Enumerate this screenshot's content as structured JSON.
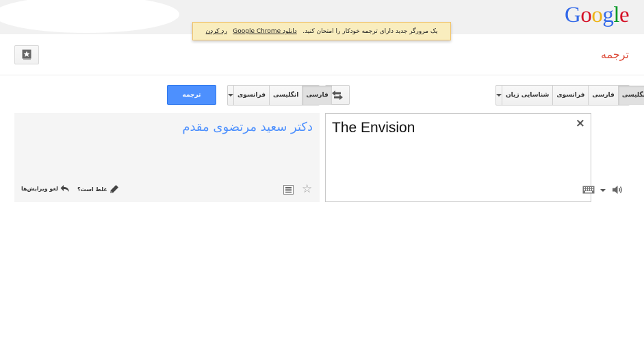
{
  "header": {
    "logo_letters": [
      "G",
      "o",
      "o",
      "g",
      "l",
      "e"
    ],
    "logo_colors": [
      "#3369e8",
      "#d50f25",
      "#eeb211",
      "#3369e8",
      "#009925",
      "#d50f25"
    ],
    "title": "ترجمه"
  },
  "notice": {
    "text": "یک مرورگر جدید دارای ترجمه خودکار را امتحان کنید.",
    "download_link": "دانلود Google Chrome",
    "dismiss_link": "رد کردن"
  },
  "source_langs": {
    "items": [
      "انگلیسی",
      "فارسی",
      "فرانسوی",
      "شناسایی زبان"
    ],
    "selected": "انگلیسی"
  },
  "target_langs": {
    "items": [
      "فارسی",
      "انگلیسی",
      "فرانسوی"
    ],
    "selected": "فارسی"
  },
  "translate_button": "ترجمه",
  "source": {
    "text": "The Envision",
    "clear_icon": "×"
  },
  "target": {
    "text": "دکتر سعید مرتضوی مقدم",
    "wrong_label": "غلط است؟",
    "undo_label": "لغو ویرایش‌ها"
  },
  "colors": {
    "accent_blue": "#4d90fe",
    "title_red": "#dd4b39",
    "notice_bg": "#f9edbe"
  }
}
